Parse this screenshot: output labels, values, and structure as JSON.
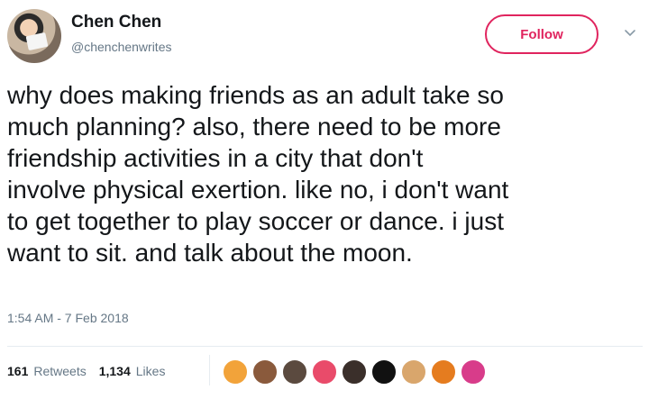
{
  "author": {
    "name": "Chen Chen",
    "handle": "@chenchenwrites"
  },
  "follow_button": {
    "label": "Follow"
  },
  "tweet": {
    "text": "why does making friends as an adult take so\nmuch planning? also, there need to be more\nfriendship activities in a city that don't\ninvolve physical exertion. like no, i don't want\nto get together to play soccer or dance. i just\nwant to sit. and talk about the moon.",
    "timestamp": "1:54 AM - 7 Feb 2018"
  },
  "stats": {
    "retweets_count": "161",
    "retweets_label": "Retweets",
    "likes_count": "1,134",
    "likes_label": "Likes"
  },
  "colors": {
    "accent": "#e0245e",
    "muted": "#657786",
    "text": "#14171a"
  },
  "likers": [
    {
      "color": "#f2a33a"
    },
    {
      "color": "#8a5a3c"
    },
    {
      "color": "#5b4a3f"
    },
    {
      "color": "#e94b6a"
    },
    {
      "color": "#3a2f2a"
    },
    {
      "color": "#111111"
    },
    {
      "color": "#d9a66c"
    },
    {
      "color": "#e57c1f"
    },
    {
      "color": "#d83c8a"
    }
  ]
}
